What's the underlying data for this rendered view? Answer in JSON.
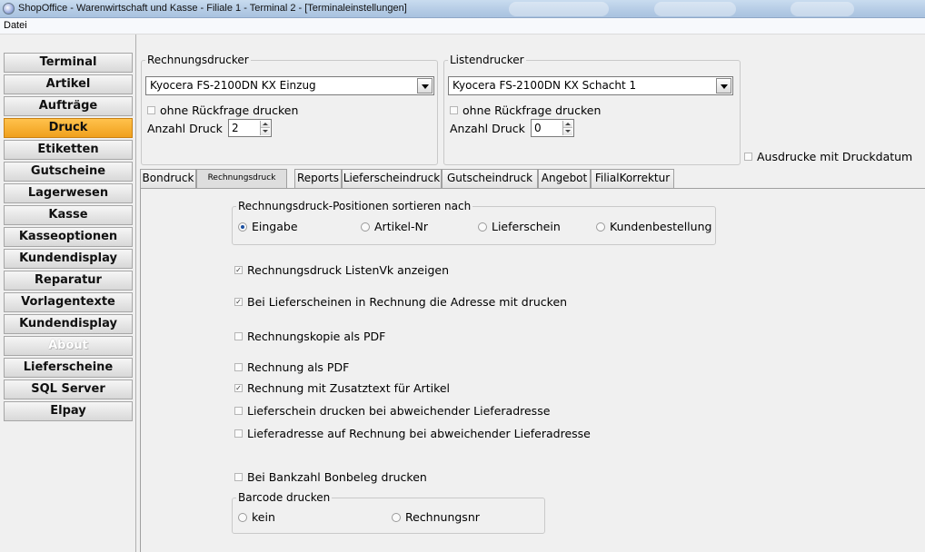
{
  "window": {
    "title": "ShopOffice - Warenwirtschaft und Kasse - Filiale 1 - Terminal 2 - [Terminaleinstellungen]"
  },
  "menu": {
    "file": "Datei"
  },
  "sidebar": {
    "items": [
      {
        "label": "Terminal"
      },
      {
        "label": "Artikel"
      },
      {
        "label": "Aufträge"
      },
      {
        "label": "Druck"
      },
      {
        "label": "Etiketten"
      },
      {
        "label": "Gutscheine"
      },
      {
        "label": "Lagerwesen"
      },
      {
        "label": "Kasse"
      },
      {
        "label": "Kasseoptionen"
      },
      {
        "label": "Kundendisplay"
      },
      {
        "label": "Reparatur"
      },
      {
        "label": "Vorlagentexte"
      },
      {
        "label": "Kundendisplay"
      },
      {
        "label": "About"
      },
      {
        "label": "Lieferscheine"
      },
      {
        "label": "SQL Server"
      },
      {
        "label": "Elpay"
      }
    ],
    "active": "Druck",
    "disabled": "About"
  },
  "invoice_printer": {
    "legend": "Rechnungsdrucker",
    "printer": "Kyocera FS-2100DN KX Einzug",
    "no_prompt_label": "ohne Rückfrage drucken",
    "copies_label": "Anzahl Druck",
    "copies": "2"
  },
  "list_printer": {
    "legend": "Listendrucker",
    "printer": "Kyocera FS-2100DN KX Schacht 1",
    "no_prompt_label": "ohne Rückfrage drucken",
    "copies_label": "Anzahl Druck",
    "copies": "0"
  },
  "print_date_label": "Ausdrucke mit Druckdatum",
  "tabs": [
    {
      "label": "Bondruck"
    },
    {
      "label": "Rechnungsdruck"
    },
    {
      "label": "Reports"
    },
    {
      "label": "Lieferscheindruck"
    },
    {
      "label": "Gutscheindruck"
    },
    {
      "label": "Angebot"
    },
    {
      "label": "FilialKorrektur"
    }
  ],
  "active_tab": "Rechnungsdruck",
  "sort": {
    "legend": "Rechnungsdruck-Positionen sortieren nach",
    "options": [
      {
        "label": "Eingabe",
        "selected": true
      },
      {
        "label": "Artikel-Nr",
        "selected": false
      },
      {
        "label": "Lieferschein",
        "selected": false
      },
      {
        "label": "Kundenbestellung",
        "selected": false
      }
    ]
  },
  "options": [
    {
      "label": "Rechnungsdruck ListenVk anzeigen",
      "checked": true
    },
    {
      "label": "Bei Lieferscheinen in Rechnung die Adresse mit drucken",
      "checked": true
    },
    {
      "label": "Rechnungskopie als PDF",
      "checked": false
    },
    {
      "label": "Rechnung als PDF",
      "checked": false
    },
    {
      "label": "Rechnung mit Zusatztext für Artikel",
      "checked": true
    },
    {
      "label": "Lieferschein drucken bei abweichender Lieferadresse",
      "checked": false
    },
    {
      "label": "Lieferadresse auf Rechnung bei abweichender Lieferadresse",
      "checked": false
    },
    {
      "label": "Bei Bankzahl Bonbeleg drucken",
      "checked": false
    }
  ],
  "barcode": {
    "legend": "Barcode drucken",
    "options": [
      {
        "label": "kein",
        "selected": false
      },
      {
        "label": "Rechnungsnr",
        "selected": false
      }
    ]
  },
  "checkmark": "✓"
}
